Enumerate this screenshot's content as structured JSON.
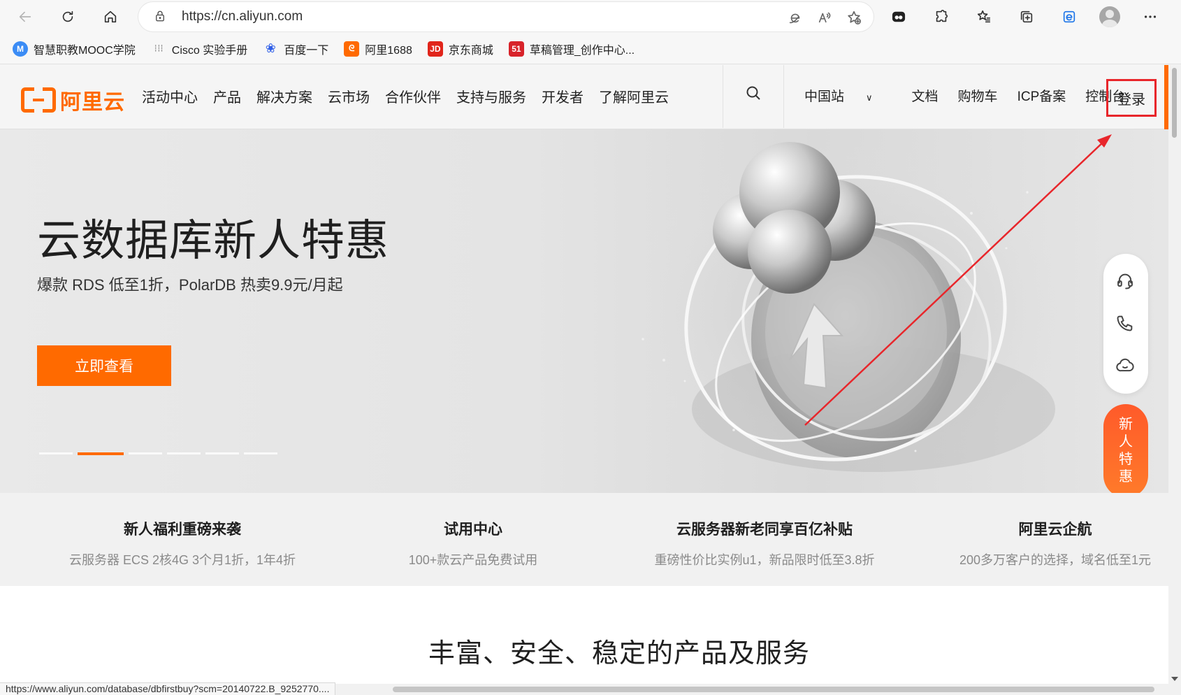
{
  "browser": {
    "url": "https://cn.aliyun.com",
    "bookmarks": [
      {
        "label": "智慧职教MOOC学院",
        "icon": "M",
        "color": "#3b8cf5"
      },
      {
        "label": "Cisco 实验手册",
        "icon": "cisco",
        "color": "#555555"
      },
      {
        "label": "百度一下",
        "icon": "baidu-paw",
        "color": "#2e5ee8"
      },
      {
        "label": "阿里1688",
        "icon": "1688",
        "color": "#ff6a00"
      },
      {
        "label": "京东商城",
        "icon": "JD",
        "color": "#e1251b"
      },
      {
        "label": "草稿管理_创作中心...",
        "icon": "51",
        "color": "#d8232a"
      }
    ],
    "status_url": "https://www.aliyun.com/database/dbfirstbuy?scm=20140722.B_9252770...."
  },
  "site": {
    "logo_text": "阿里云",
    "nav": [
      "活动中心",
      "产品",
      "解决方案",
      "云市场",
      "合作伙伴",
      "支持与服务",
      "开发者",
      "了解阿里云"
    ],
    "right_nav": [
      "中国站",
      "文档",
      "购物车",
      "ICP备案",
      "控制台"
    ],
    "login": "登录",
    "accent": "#ff6a00"
  },
  "hero": {
    "title": "云数据库新人特惠",
    "subtitle": "爆款 RDS 低至1折，PolarDB 热卖9.9元/月起",
    "cta": "立即查看",
    "carousel_count": 6,
    "carousel_active": 2
  },
  "float_tools": {
    "promo": [
      "新",
      "人",
      "特",
      "惠"
    ]
  },
  "features": [
    {
      "title": "新人福利重磅来袭",
      "desc": "云服务器 ECS 2核4G 3个月1折，1年4折"
    },
    {
      "title": "试用中心",
      "desc": "100+款云产品免费试用"
    },
    {
      "title": "云服务器新老同享百亿补贴",
      "desc": "重磅性价比实例u1，新品限时低至3.8折"
    },
    {
      "title": "阿里云企航",
      "desc": "200多万客户的选择，域名低至1元"
    }
  ],
  "section": {
    "title": "丰富、安全、稳定的产品及服务"
  }
}
